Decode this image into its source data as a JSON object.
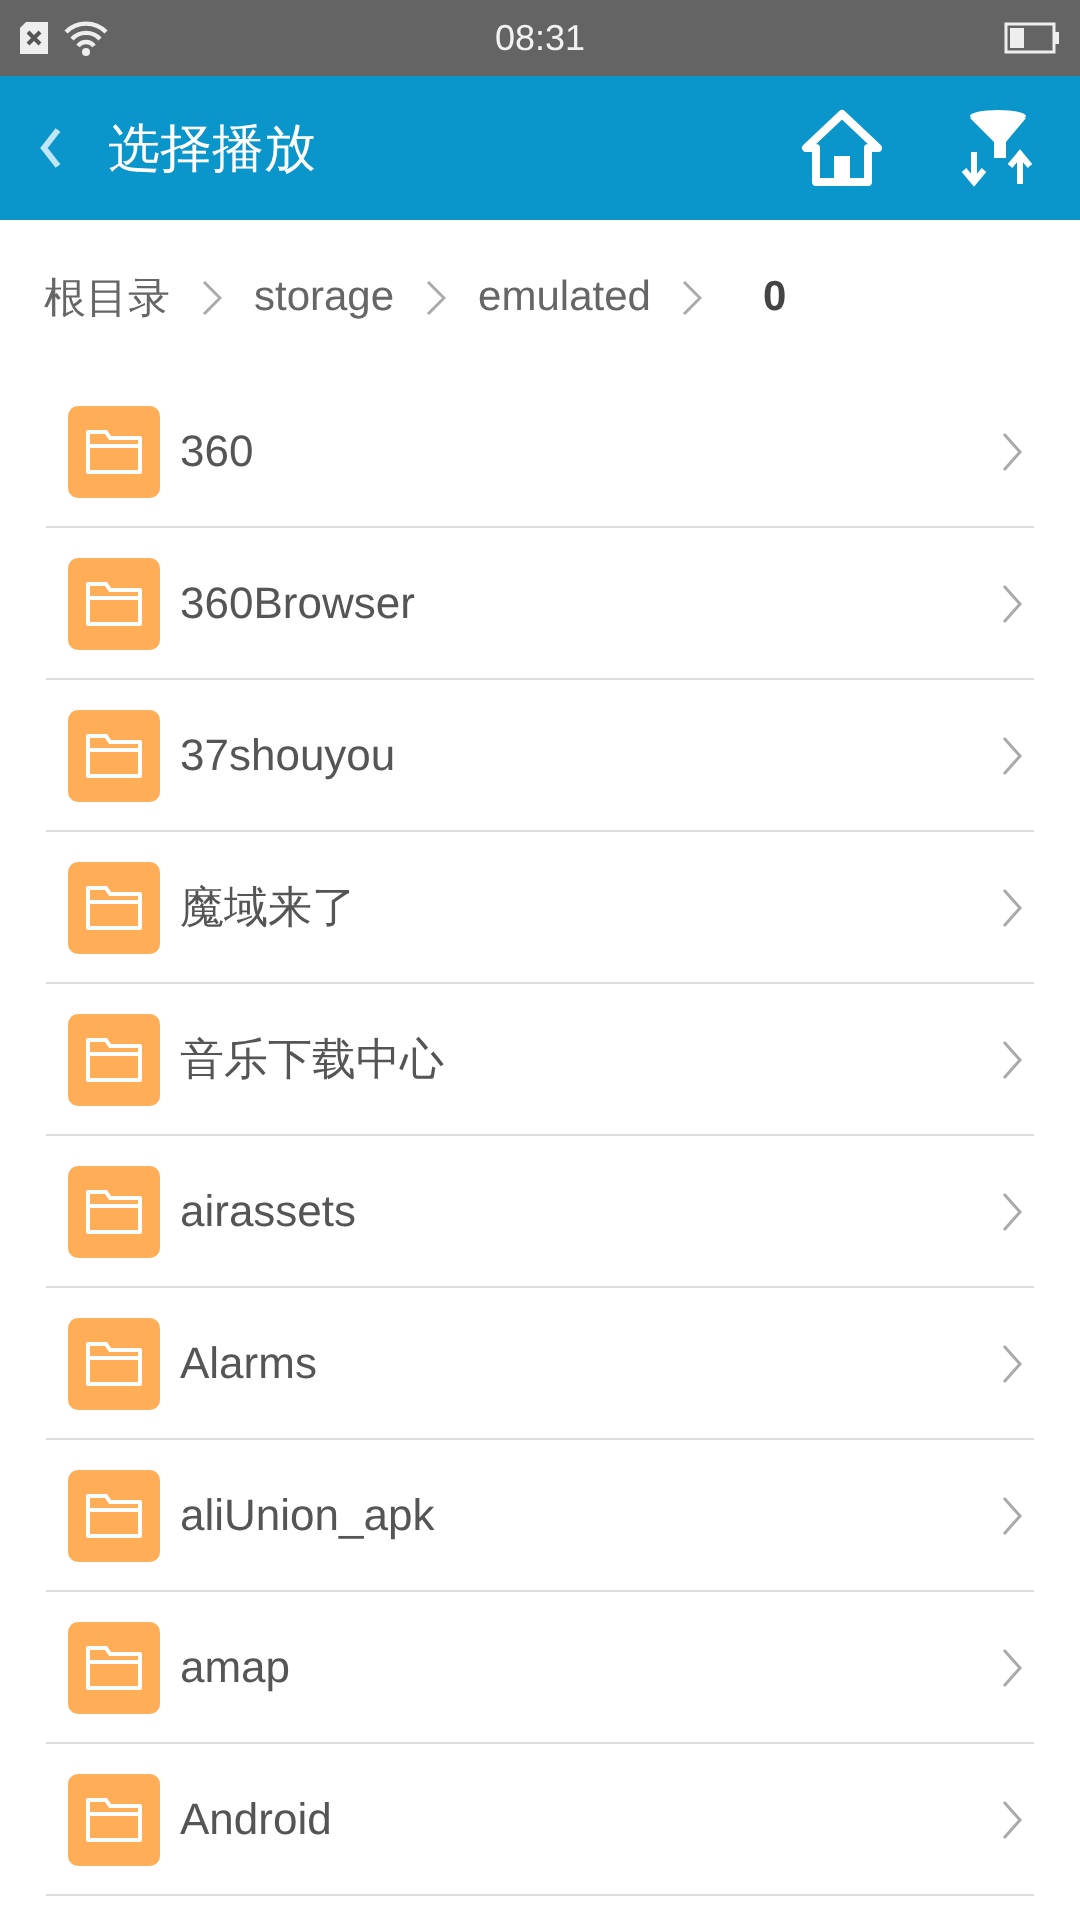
{
  "status_bar": {
    "time": "08:31"
  },
  "header": {
    "title": "选择播放"
  },
  "breadcrumb": [
    {
      "label": "根目录",
      "current": false
    },
    {
      "label": "storage",
      "current": false
    },
    {
      "label": "emulated",
      "current": false
    },
    {
      "label": "0",
      "current": true
    }
  ],
  "folders": [
    {
      "name": "360"
    },
    {
      "name": "360Browser"
    },
    {
      "name": "37shouyou"
    },
    {
      "name": "魔域来了"
    },
    {
      "name": "音乐下载中心"
    },
    {
      "name": "airassets"
    },
    {
      "name": "Alarms"
    },
    {
      "name": "aliUnion_apk"
    },
    {
      "name": "amap"
    },
    {
      "name": "Android"
    }
  ]
}
